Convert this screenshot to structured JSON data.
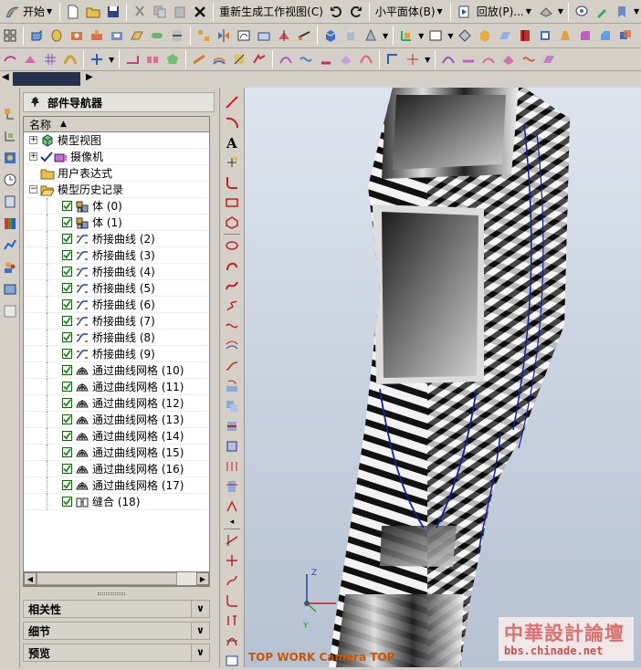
{
  "menubar": {
    "start_label": "开始",
    "regen_label": "重新生成工作视图(C)",
    "plane_label": "小平面体(B)",
    "replay_label": "回放(P)..."
  },
  "nav": {
    "title": "部件导航器",
    "column_name": "名称",
    "items": [
      {
        "label": "模型视图",
        "level": 0,
        "expander": "+",
        "check": false,
        "icon": "model-views-icon"
      },
      {
        "label": "摄像机",
        "level": 0,
        "expander": "+",
        "check": true,
        "icon": "camera-icon"
      },
      {
        "label": "用户表达式",
        "level": 0,
        "expander": "",
        "check": false,
        "icon": "folder-icon"
      },
      {
        "label": "模型历史记录",
        "level": 0,
        "expander": "−",
        "check": false,
        "icon": "folder-open-icon"
      },
      {
        "label": "体 (0)",
        "level": 1,
        "check": true,
        "icon": "body-icon"
      },
      {
        "label": "体 (1)",
        "level": 1,
        "check": true,
        "icon": "body-icon"
      },
      {
        "label": "桥接曲线 (2)",
        "level": 1,
        "check": true,
        "icon": "bridge-curve-icon"
      },
      {
        "label": "桥接曲线 (3)",
        "level": 1,
        "check": true,
        "icon": "bridge-curve-icon"
      },
      {
        "label": "桥接曲线 (4)",
        "level": 1,
        "check": true,
        "icon": "bridge-curve-icon"
      },
      {
        "label": "桥接曲线 (5)",
        "level": 1,
        "check": true,
        "icon": "bridge-curve-icon"
      },
      {
        "label": "桥接曲线 (6)",
        "level": 1,
        "check": true,
        "icon": "bridge-curve-icon"
      },
      {
        "label": "桥接曲线 (7)",
        "level": 1,
        "check": true,
        "icon": "bridge-curve-icon"
      },
      {
        "label": "桥接曲线 (8)",
        "level": 1,
        "check": true,
        "icon": "bridge-curve-icon"
      },
      {
        "label": "桥接曲线 (9)",
        "level": 1,
        "check": true,
        "icon": "bridge-curve-icon"
      },
      {
        "label": "通过曲线网格 (10)",
        "level": 1,
        "check": true,
        "icon": "curve-mesh-icon"
      },
      {
        "label": "通过曲线网格 (11)",
        "level": 1,
        "check": true,
        "icon": "curve-mesh-icon"
      },
      {
        "label": "通过曲线网格 (12)",
        "level": 1,
        "check": true,
        "icon": "curve-mesh-icon"
      },
      {
        "label": "通过曲线网格 (13)",
        "level": 1,
        "check": true,
        "icon": "curve-mesh-icon"
      },
      {
        "label": "通过曲线网格 (14)",
        "level": 1,
        "check": true,
        "icon": "curve-mesh-icon"
      },
      {
        "label": "通过曲线网格 (15)",
        "level": 1,
        "check": true,
        "icon": "curve-mesh-icon"
      },
      {
        "label": "通过曲线网格 (16)",
        "level": 1,
        "check": true,
        "icon": "curve-mesh-icon"
      },
      {
        "label": "通过曲线网格 (17)",
        "level": 1,
        "check": true,
        "icon": "curve-mesh-icon"
      },
      {
        "label": "缝合 (18)",
        "level": 1,
        "check": true,
        "icon": "sew-icon"
      }
    ],
    "sections": [
      "相关性",
      "细节",
      "预览"
    ]
  },
  "viewport": {
    "label": "TOP WORK Camera TOP",
    "axis_z": "Z",
    "axis_y": "Y"
  },
  "watermark": {
    "line1": "中華設計論壇",
    "line2": "bbs.chinade.net"
  },
  "colors": {
    "accent": "#26304d",
    "curve": "#1020a0",
    "label": "#cc5500"
  }
}
